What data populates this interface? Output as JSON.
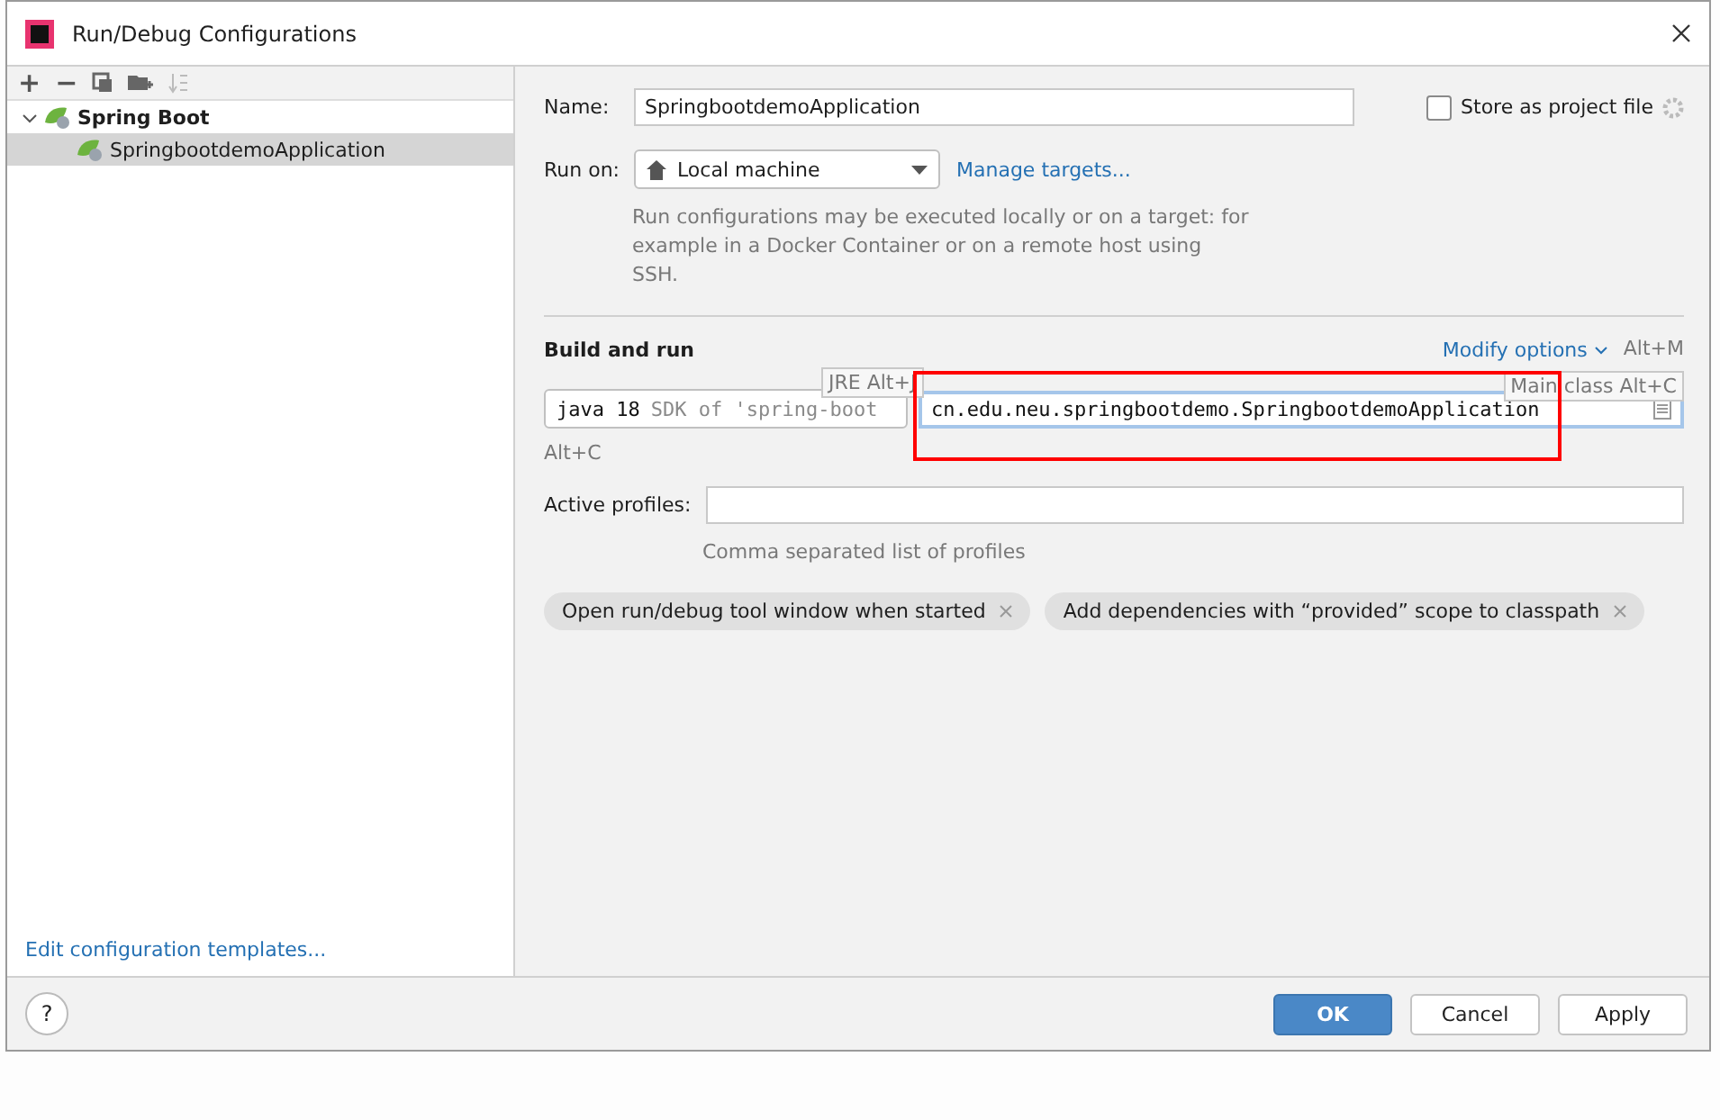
{
  "window": {
    "title": "Run/Debug Configurations"
  },
  "toolbar": [
    "+",
    "−"
  ],
  "tree": [
    {
      "label": "Spring Boot",
      "expanded": true,
      "selected": false,
      "children": [
        {
          "label": "SpringbootdemoApplication",
          "selected": true
        }
      ]
    }
  ],
  "edit_templates_link": "Edit configuration templates...",
  "form": {
    "name_label": "Name:",
    "name_value": "SpringbootdemoApplication",
    "store_label": "Store as project file",
    "store_checked": false,
    "run_on_label": "Run on:",
    "run_on_value": "Local machine",
    "manage_targets": "Manage targets...",
    "run_on_hint": "Run configurations may be executed locally or on a target: for example in a Docker Container or on a remote host using SSH.",
    "build_title": "Build and run",
    "modify_options": "Modify options",
    "modify_shortcut": "Alt+M",
    "jre_hint": "JRE Alt+J",
    "jre_java": "java 18",
    "jre_sdk": "SDK of 'spring-boot",
    "main_class_hint": "Main class Alt+C",
    "main_class_value": "cn.edu.neu.springbootdemo.SpringbootdemoApplication",
    "alt_c": "Alt+C",
    "profiles_label": "Active profiles:",
    "profiles_hint": "Comma separated list of profiles",
    "chips": [
      "Open run/debug tool window when started",
      "Add dependencies with “provided” scope to classpath"
    ]
  },
  "buttons": [
    {
      "label": "OK",
      "kind": "primary"
    },
    {
      "label": "Cancel",
      "kind": "normal"
    },
    {
      "label": "Apply",
      "kind": "normal"
    }
  ],
  "help": "?"
}
